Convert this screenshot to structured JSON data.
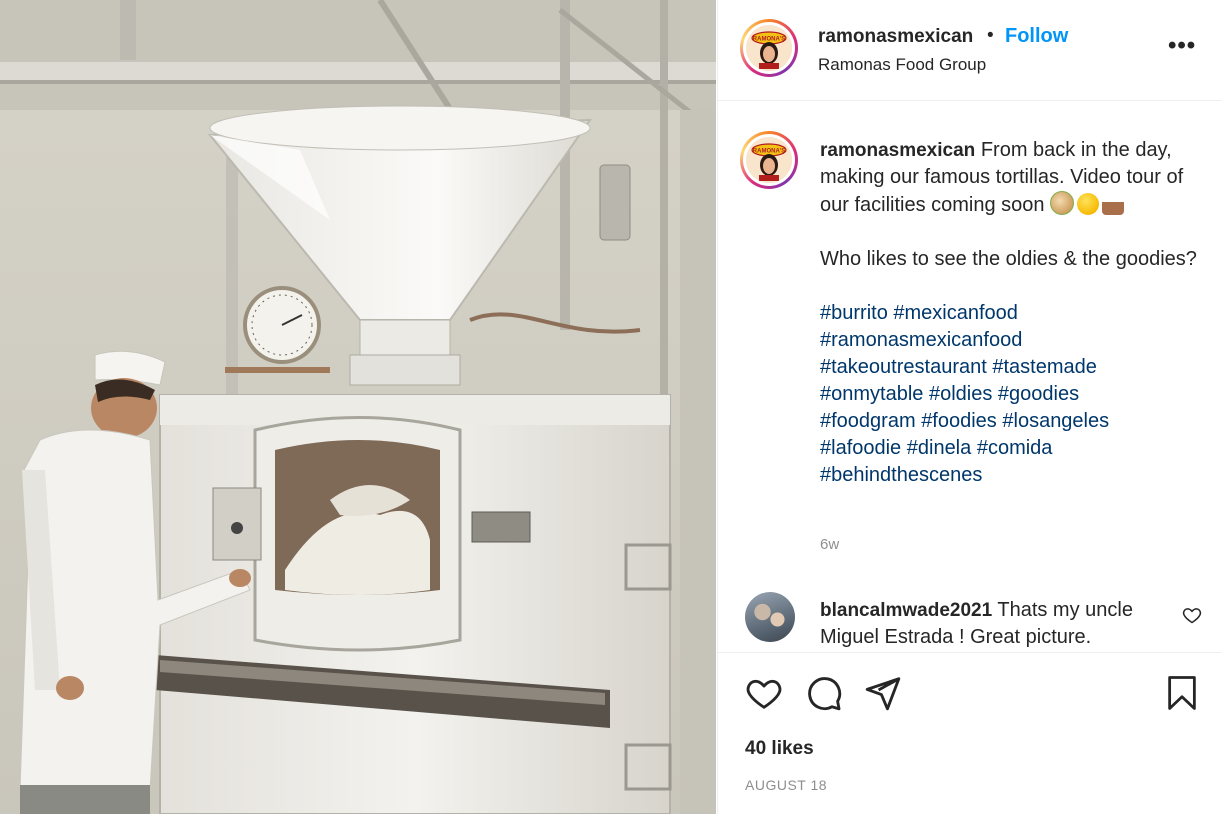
{
  "post": {
    "photo_alt": "photo",
    "author": {
      "username": "ramonasmexican",
      "separator": "•",
      "follow_label": "Follow",
      "location": "Ramonas Food Group",
      "more_label": "•••",
      "logo_text": "RAMONA'S"
    },
    "caption": {
      "username": "ramonasmexican",
      "text_1": "From back in the day, making our famous tortillas. Video tour of our facilities coming soon",
      "emojis": [
        "burrito-emoji",
        "smirk-emoji",
        "chef-emoji"
      ],
      "text_2": "Who likes to see the oldies & the goodies?",
      "hashtags": [
        [
          "#burrito",
          "#mexicanfood"
        ],
        [
          "#ramonasmexicanfood"
        ],
        [
          "#takeoutrestaurant",
          "#tastemade"
        ],
        [
          "#onmytable",
          "#oldies",
          "#goodies"
        ],
        [
          "#foodgram",
          "#foodies",
          "#losangeles"
        ],
        [
          "#lafoodie",
          "#dinela",
          "#comida"
        ],
        [
          "#behindthescenes"
        ]
      ],
      "age": "6w"
    },
    "comment": {
      "username": "blancalmwade2021",
      "text": "Thats my uncle Miguel Estrada ! Great picture."
    },
    "likes": "40 likes",
    "date": "AUGUST 18",
    "icons": [
      "heart-icon",
      "comment-icon",
      "share-icon",
      "bookmark-icon"
    ]
  }
}
